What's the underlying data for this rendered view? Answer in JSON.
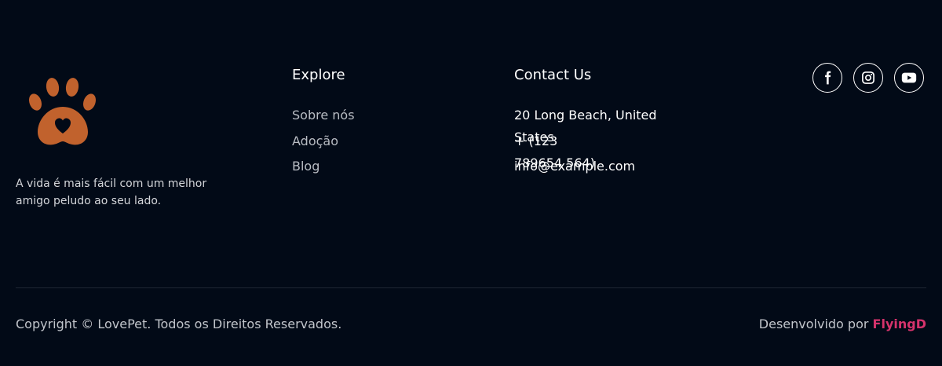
{
  "brand": {
    "logo_icon": "paw-heart-icon",
    "logo_color": "#c1622d",
    "tagline": "A vida é mais fácil com um melhor amigo peludo ao seu lado."
  },
  "explore": {
    "title": "Explore",
    "links": [
      {
        "label": "Sobre nós"
      },
      {
        "label": "Adoção"
      },
      {
        "label": "Blog"
      }
    ]
  },
  "contact": {
    "title": "Contact Us",
    "address": "20 Long Beach, United States",
    "phone": "+ (123 789654 564)",
    "email": "info@example.com"
  },
  "social": [
    {
      "icon": "facebook-icon"
    },
    {
      "icon": "instagram-icon"
    },
    {
      "icon": "youtube-icon"
    }
  ],
  "bottom": {
    "copyright": "Copyright © LovePet. Todos os Direitos Reservados.",
    "developed_by_prefix": "Desenvolvido por",
    "developer_name": "FlyingD",
    "developer_color": "#d6336c"
  },
  "colors": {
    "background": "#020a17",
    "text": "#ffffff",
    "muted_text": "#b8bcc3"
  }
}
